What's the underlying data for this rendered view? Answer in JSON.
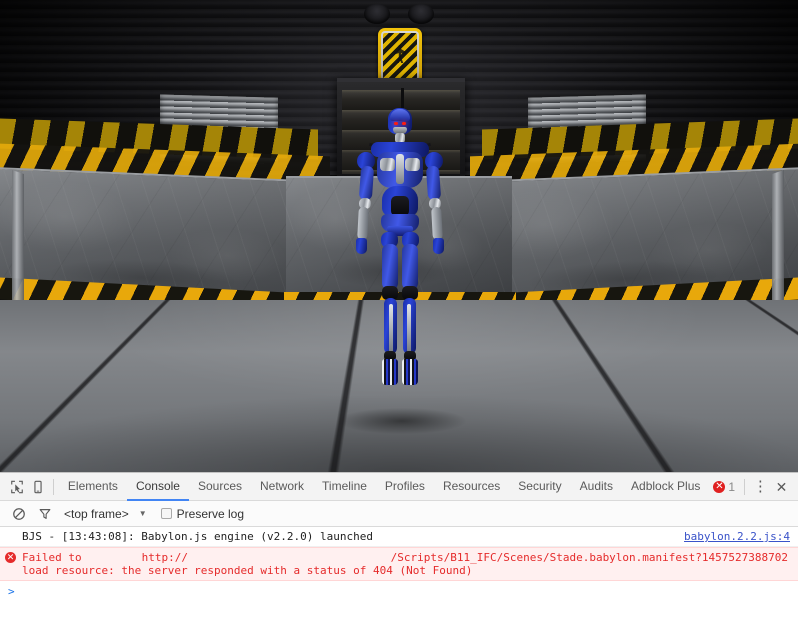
{
  "scene": {
    "name": "babylon-3d-viewport",
    "description": "Babylon.js WebGL scene: blue humanoid robot standing in an industrial hangar",
    "sign_label": "hazard-sign",
    "robot_label": "blue-humanoid-robot"
  },
  "devtools": {
    "icons": {
      "inspect": "inspect-element-icon",
      "device": "device-toolbar-icon",
      "menu": "⋮",
      "close": "✕"
    },
    "tabs": [
      {
        "label": "Elements",
        "active": false
      },
      {
        "label": "Console",
        "active": true
      },
      {
        "label": "Sources",
        "active": false
      },
      {
        "label": "Network",
        "active": false
      },
      {
        "label": "Timeline",
        "active": false
      },
      {
        "label": "Profiles",
        "active": false
      },
      {
        "label": "Resources",
        "active": false
      },
      {
        "label": "Security",
        "active": false
      },
      {
        "label": "Audits",
        "active": false
      },
      {
        "label": "Adblock Plus",
        "active": false
      }
    ],
    "error_badge": {
      "symbol": "✕",
      "count": "1"
    },
    "filterbar": {
      "clear_icon": "clear-console-icon",
      "filter_icon": "filter-icon",
      "context": "<top frame>",
      "caret": "▼",
      "preserve_log": "Preserve log",
      "preserve_log_checked": false
    },
    "console": {
      "messages": [
        {
          "type": "log",
          "text": "BJS - [13:43:08]: Babylon.js engine (v2.2.0) launched",
          "source": "babylon.2.2.js:4"
        },
        {
          "type": "error",
          "icon": "✕",
          "line1_a": "Failed to",
          "line1_b": "http://",
          "line1_c": "/Scripts/B11_IFC/Scenes/Stade.babylon.manifest?1457527388702",
          "line2": "load resource: the server responded with a status of 404 (Not Found)"
        }
      ],
      "prompt": ">"
    }
  },
  "colors": {
    "accent_blue": "#4285f4",
    "error_red": "#e52b2b",
    "error_bg": "#fff0f0",
    "link_blue": "#3a53c9",
    "robot_blue": "#2a44d8",
    "hazard_yellow": "#e3a90a"
  }
}
